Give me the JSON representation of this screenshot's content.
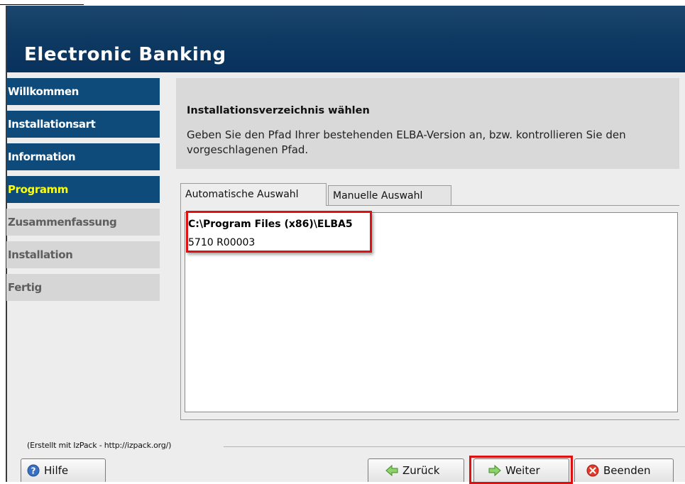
{
  "app": {
    "title": "Electronic Banking"
  },
  "nav": {
    "items": [
      {
        "label": "Willkommen",
        "state": "done"
      },
      {
        "label": "Installationsart",
        "state": "done"
      },
      {
        "label": "Information",
        "state": "done"
      },
      {
        "label": "Programm",
        "state": "current"
      },
      {
        "label": "Zusammenfassung",
        "state": "pending"
      },
      {
        "label": "Installation",
        "state": "pending"
      },
      {
        "label": "Fertig",
        "state": "pending"
      }
    ]
  },
  "header": {
    "heading": "Installationsverzeichnis wählen",
    "description": "Geben Sie den Pfad Ihrer bestehenden ELBA-Version an, bzw. kontrollieren Sie den vorgeschlagenen Pfad."
  },
  "tabs": [
    {
      "label": "Automatische Auswahl",
      "active": true
    },
    {
      "label": "Manuelle Auswahl",
      "active": false
    }
  ],
  "selection": {
    "path": "C:\\Program Files (x86)\\ELBA5",
    "version": "5710 R00003"
  },
  "footer": {
    "credit": "(Erstellt mit IzPack - http://izpack.org/)",
    "help_label": "Hilfe",
    "back_label": "Zurück",
    "next_label": "Weiter",
    "quit_label": "Beenden"
  },
  "colors": {
    "banner": "#0f3a62",
    "nav_done": "#0e4a7a",
    "nav_current_text": "#ffff00",
    "highlight": "#e01010"
  },
  "icons": {
    "help": "help-circle-icon",
    "back": "arrow-left-icon",
    "next": "arrow-right-icon",
    "quit": "close-circle-icon"
  }
}
